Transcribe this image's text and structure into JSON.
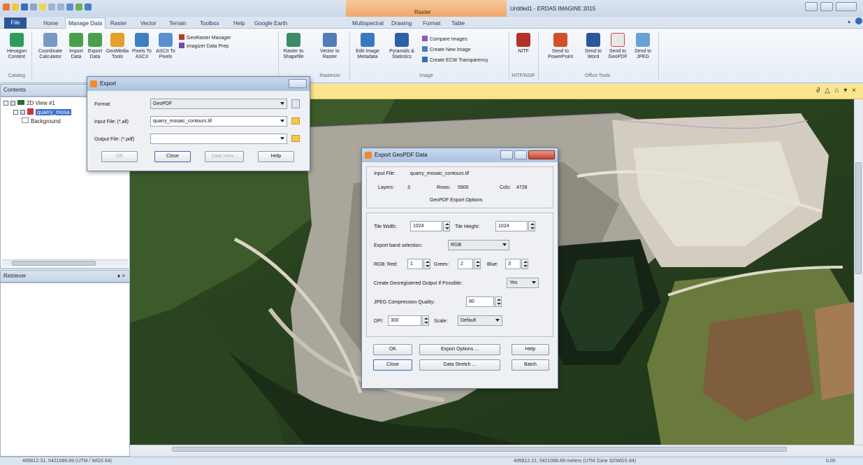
{
  "app": {
    "title": "Untitled1 - ERDAS IMAGINE 2015",
    "context_tab_group": "Raster"
  },
  "ribbon_tabs": [
    "File",
    "Home",
    "Manage Data",
    "Raster",
    "Vector",
    "Terrain",
    "Toolbox",
    "Help",
    "Google Earth",
    "Multispectral",
    "Drawing",
    "Format",
    "Table"
  ],
  "ribbon": {
    "buttons": [
      {
        "label": "Hexagon Content"
      },
      {
        "label": "Coordinate Calculator"
      },
      {
        "label": "Import Data"
      },
      {
        "label": "Export Data"
      },
      {
        "label": "GeoMedia Tools"
      },
      {
        "label": "Pixels To ASCII"
      },
      {
        "label": "ASCII To Pixels"
      },
      {
        "label": "Raster to Shapefile"
      },
      {
        "label": "Vector to Raster"
      },
      {
        "label": "Edit Image Metadata"
      },
      {
        "label": "Pyramids & Statistics"
      },
      {
        "label": "NITF"
      },
      {
        "label": "Send to PowerPoint"
      },
      {
        "label": "Send to Word"
      },
      {
        "label": "Send to GeoPDF"
      },
      {
        "label": "Send to JPEG"
      }
    ],
    "small_items": [
      "GeoRaster Manager",
      "Imagizer Data Prep",
      "Compare Images",
      "Create New Image",
      "Create ECW Transparency"
    ],
    "groups": [
      "Catalog",
      "Rasterize",
      "Image",
      "NITF/NSIF",
      "Office Tools"
    ]
  },
  "contents": {
    "header": "Contents",
    "view": "2D View #1",
    "layer": "quarry_mosa",
    "background": "Background"
  },
  "retriever": {
    "header": "Retriever",
    "controls": "♦ ×"
  },
  "viewer_controls": "∂ △ ⌂ ▾ ×",
  "export_dialog": {
    "title": "Export",
    "format_label": "Format",
    "format_value": "GeoPDF",
    "input_label": "Input File: (*.all)",
    "input_value": "quarry_mosaic_contours.tif",
    "output_label": "Output File: (*.pdf)",
    "output_value": "",
    "ok": "OK",
    "close": "Close",
    "data_view": "Data View...",
    "help": "Help"
  },
  "geopdf_dialog": {
    "title": "Export GeoPDF Data",
    "input_file_label": "Input File:",
    "input_file_value": "quarry_mosaic_contours.tif",
    "layers_label": "Layers:",
    "layers_value": "3",
    "rows_label": "Rows:",
    "rows_value": "5900",
    "cols_label": "Cols:",
    "cols_value": "4728",
    "options_header": "GeoPDF Export Options",
    "tile_width_label": "Tile Width:",
    "tile_width_value": "1024",
    "tile_height_label": "Tile Height:",
    "tile_height_value": "1024",
    "band_selection_label": "Export band selection:",
    "band_selection_value": "RGB",
    "rgb_label": "RGB: Red:",
    "red_value": "1",
    "green_label": "Green:",
    "green_value": "2",
    "blue_label": "Blue:",
    "blue_value": "3",
    "georegistered_label": "Create Georegistered Output If Possible:",
    "georegistered_value": "Yes",
    "jpeg_quality_label": "JPEG Compression Quality:",
    "jpeg_quality_value": "80",
    "dpi_label": "DPI:",
    "dpi_value": "300",
    "scale_label": "Scale:",
    "scale_value": "Default",
    "ok": "OK",
    "export_options": "Export Options ...",
    "help": "Help",
    "close": "Close",
    "data_stretch": "Data Stretch ...",
    "batch": "Batch"
  },
  "statusbar": {
    "left": "495812.31, 5421086.89  (UTM / WGS 84)",
    "center": "495812.31, 5421086.89 meters (UTM Zone 32/WGS 84)",
    "right": "0.00"
  }
}
